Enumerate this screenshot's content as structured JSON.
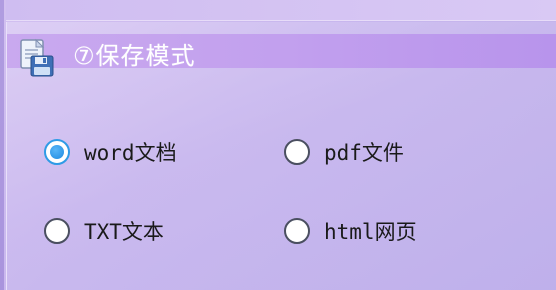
{
  "panel": {
    "title": "⑦保存模式",
    "icon": "save-document-icon"
  },
  "options": [
    {
      "label": "word文档",
      "selected": true
    },
    {
      "label": "pdf文件",
      "selected": false
    },
    {
      "label": "TXT文本",
      "selected": false
    },
    {
      "label": "html网页",
      "selected": false
    }
  ],
  "colors": {
    "accent": "#2f9be6",
    "header": "#c2a0ee",
    "background": "#c8b7ee",
    "title_text": "#ffffff"
  }
}
